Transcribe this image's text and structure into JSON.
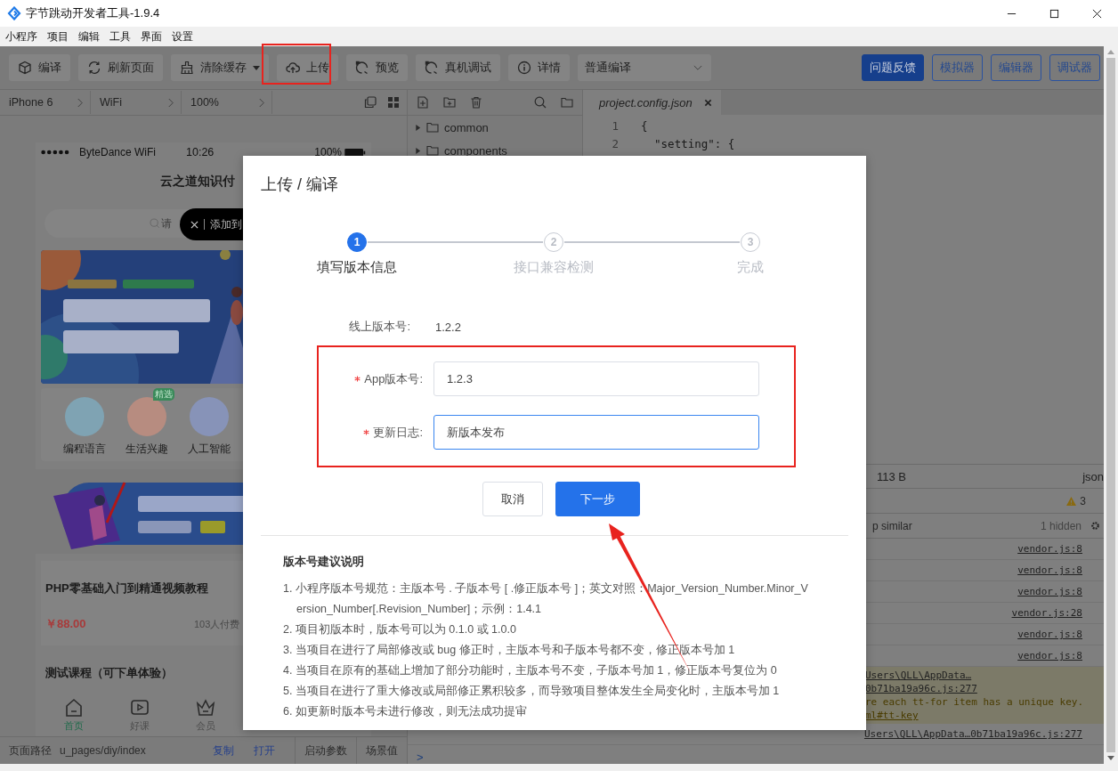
{
  "window": {
    "title": "字节跳动开发者工具-1.9.4"
  },
  "menu": [
    "小程序",
    "项目",
    "编辑",
    "工具",
    "界面",
    "设置"
  ],
  "toolbar": {
    "buttons": [
      {
        "label": "编译",
        "kind": "cube",
        "dropdown": false
      },
      {
        "label": "刷新页面",
        "kind": "refresh",
        "dropdown": false
      },
      {
        "label": "清除缓存",
        "kind": "broom",
        "dropdown": true
      },
      {
        "label": "上传",
        "kind": "upload",
        "dropdown": false
      },
      {
        "label": "预览",
        "kind": "preview",
        "dropdown": false
      },
      {
        "label": "真机调试",
        "kind": "preview",
        "dropdown": false
      },
      {
        "label": "详情",
        "kind": "info",
        "dropdown": false
      }
    ],
    "compile_mode": "普通编译",
    "right_buttons": [
      {
        "label": "问题反馈",
        "primary": true
      },
      {
        "label": "模拟器",
        "primary": false
      },
      {
        "label": "编辑器",
        "primary": false
      },
      {
        "label": "调试器",
        "primary": false
      }
    ]
  },
  "simulator": {
    "selectors": [
      "iPhone 6",
      "WiFi",
      "100%"
    ]
  },
  "phone": {
    "carrier": "ByteDance WiFi",
    "time": "10:26",
    "battery": "100%",
    "title": "云之道知识付",
    "search_placeholder": "请",
    "toast": "添加到",
    "categories": [
      {
        "label": "编程语言",
        "color": "#7fa3b3"
      },
      {
        "label": "生活兴趣",
        "color": "#b78c80",
        "badge": "精选"
      },
      {
        "label": "人工智能",
        "color": "#8793b8"
      }
    ],
    "course": {
      "title": "PHP零基础入门到精通视频教程",
      "price": "￥88.00",
      "buyers": "103人付费"
    },
    "course_2": {
      "title": "测试课程（可下单体验）"
    },
    "tabbar": [
      {
        "label": "首页",
        "kind": "home",
        "selected": true
      },
      {
        "label": "好课",
        "kind": "play",
        "selected": false
      },
      {
        "label": "会员",
        "kind": "crown",
        "selected": false
      }
    ]
  },
  "page_path": {
    "label": "页面路径",
    "value": "u_pages/diy/index",
    "actions": [
      "复制",
      "打开"
    ],
    "tabs": [
      "启动参数",
      "场景值"
    ]
  },
  "file_tree": [
    {
      "name": "common",
      "expanded": false
    },
    {
      "name": "components",
      "expanded": false
    }
  ],
  "editor": {
    "tab": "project.config.json",
    "lines": [
      {
        "number": "1",
        "code": "{"
      },
      {
        "number": "2",
        "code": "  \"setting\": {"
      }
    ]
  },
  "file_info": {
    "size": "113 B",
    "type": "json"
  },
  "console": {
    "warnings": "3",
    "filter": "p similar",
    "hidden": "1 hidden",
    "prompt": ">",
    "rows": [
      {
        "kind": "log",
        "source": "vendor.js:8"
      },
      {
        "kind": "log",
        "source": "vendor.js:8"
      },
      {
        "kind": "log",
        "source": "vendor.js:8"
      },
      {
        "kind": "log",
        "source": "vendor.js:28"
      },
      {
        "kind": "log",
        "source": "vendor.js:8"
      },
      {
        "kind": "log",
        "source": "vendor.js:8"
      },
      {
        "kind": "warning",
        "source": "Users\\QLL\\AppData…0b71ba19a96c.js:277",
        "message": "re each tt-for item has a unique key.",
        "link": "ml#tt-key"
      },
      {
        "kind": "log",
        "source": "Users\\QLL\\AppData…0b71ba19a96c.js:277"
      }
    ]
  },
  "dialog": {
    "title": "上传 / 编译",
    "steps": [
      {
        "number": "1",
        "label": "填写版本信息",
        "selected": true
      },
      {
        "number": "2",
        "label": "接口兼容检测",
        "selected": false
      },
      {
        "number": "3",
        "label": "完成",
        "selected": false
      }
    ],
    "online_version": {
      "label": "线上版本号:",
      "value": "1.2.2"
    },
    "fields": [
      {
        "label": "App版本号:",
        "required": true,
        "value": "1.2.3",
        "focused": false
      },
      {
        "label": "更新日志:",
        "required": true,
        "value": "新版本发布",
        "focused": true
      }
    ],
    "buttons": [
      {
        "label": "取消",
        "primary": false
      },
      {
        "label": "下一步",
        "primary": true
      }
    ],
    "notes": {
      "title": "版本号建议说明",
      "items": [
        "1. 小程序版本号规范：主版本号 . 子版本号 [ .修正版本号 ]；英文对照：Major_Version_Number.Minor_Version_Number[.Revision_Number]；示例：1.4.1",
        "2. 项目初版本时，版本号可以为 0.1.0 或 1.0.0",
        "3. 当项目在进行了局部修改或 bug 修正时，主版本号和子版本号都不变，修正版本号加 1",
        "4. 当项目在原有的基础上增加了部分功能时，主版本号不变，子版本号加 1，修正版本号复位为 0",
        "5. 当项目在进行了重大修改或局部修正累积较多，而导致项目整体发生全局变化时，主版本号加 1",
        "6. 如更新时版本号未进行修改，则无法成功提审"
      ]
    }
  }
}
